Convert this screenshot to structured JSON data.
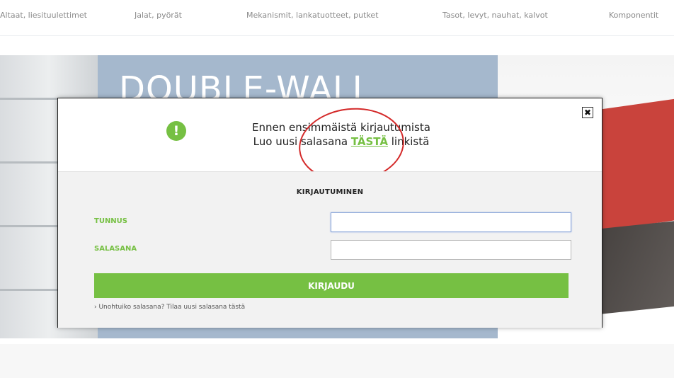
{
  "nav": {
    "items": [
      {
        "label": "Altaat, liesituulettimet"
      },
      {
        "label": "Jalat, pyörät"
      },
      {
        "label": "Mekanismit, lankatuotteet, putket"
      },
      {
        "label": "Tasot, levyt, nauhat, kalvot"
      },
      {
        "label": "Komponentit"
      }
    ]
  },
  "banner": {
    "title": "DOUBLE-WALL"
  },
  "modal": {
    "close_label": "✖",
    "alert_icon": "exclamation-icon",
    "notice_line1": "Ennen ensimmäistä kirjautumista",
    "notice_line2_prefix": "Luo uusi salasana ",
    "notice_link": "TÄSTÄ",
    "notice_line2_suffix": " linkistä",
    "login": {
      "title": "KIRJAUTUMINEN",
      "username_label": "TUNNUS",
      "username_value": "",
      "password_label": "SALASANA",
      "password_value": "",
      "submit_label": "KIRJAUDU",
      "forgot_text": "› Unohtuiko salasana? Tilaa uusi salasana tästä"
    }
  },
  "colors": {
    "accent_green": "#76c043",
    "banner_blue": "#a5b8cd",
    "annotation_red": "#d42a2a"
  }
}
